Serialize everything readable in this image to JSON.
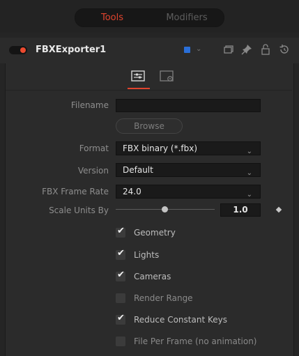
{
  "tabs": {
    "tools": "Tools",
    "modifiers": "Modifiers"
  },
  "header": {
    "node_name": "FBXExporter1"
  },
  "panel": {
    "filename": {
      "label": "Filename",
      "value": ""
    },
    "browse_label": "Browse",
    "format": {
      "label": "Format",
      "value": "FBX binary (*.fbx)"
    },
    "version": {
      "label": "Version",
      "value": "Default"
    },
    "frame_rate": {
      "label": "FBX Frame Rate",
      "value": "24.0"
    },
    "scale": {
      "label": "Scale Units By",
      "value": "1.0"
    },
    "checkboxes": [
      {
        "label": "Geometry",
        "checked": true
      },
      {
        "label": "Lights",
        "checked": true
      },
      {
        "label": "Cameras",
        "checked": true
      },
      {
        "label": "Render Range",
        "checked": false
      },
      {
        "label": "Reduce Constant Keys",
        "checked": true
      },
      {
        "label": "File Per Frame (no animation)",
        "checked": false
      }
    ]
  },
  "colors": {
    "accent": "#e0442e",
    "node_color": "#2a6fd8",
    "background": "#252525"
  },
  "icons": [
    "settings-sliders-icon",
    "settings-gear-icon",
    "copy-icon",
    "pin-icon",
    "lock-icon",
    "reset-icon",
    "keyframe-icon"
  ]
}
